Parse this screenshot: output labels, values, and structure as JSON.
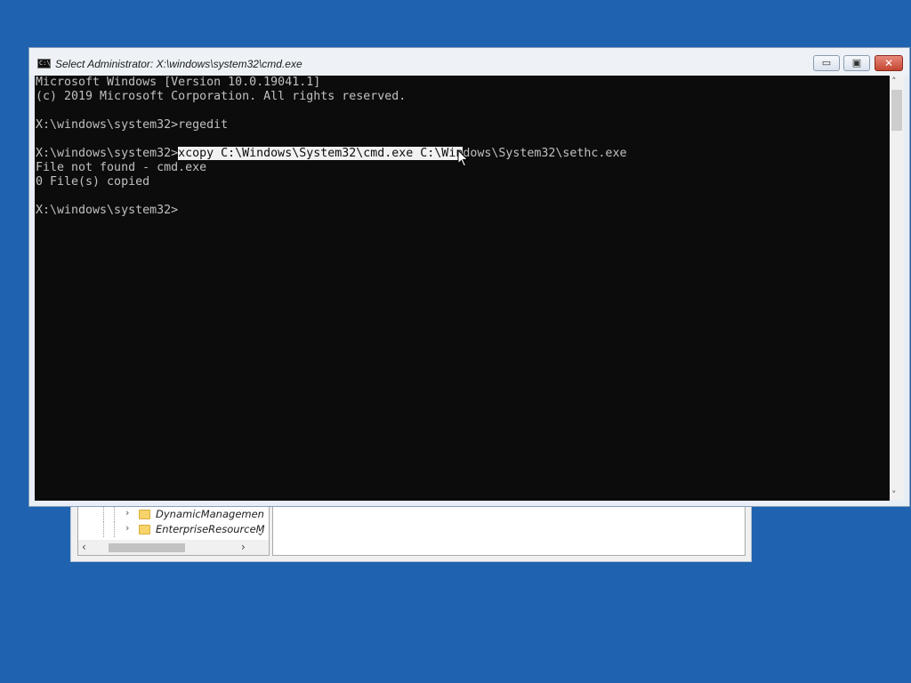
{
  "regedit": {
    "tree_items": [
      {
        "label": "DynamicManagemen",
        "expander": "›"
      },
      {
        "label": "EnterpriseResourceM",
        "expander": "›"
      }
    ],
    "tree_vscroll_glyph": "⌄",
    "hscroll_left_glyph": "‹",
    "hscroll_right_glyph": "›"
  },
  "cmd": {
    "title": "Select Administrator: X:\\windows\\system32\\cmd.exe",
    "icon_text": "C:\\",
    "buttons": {
      "minimize": "▭",
      "maximize": "▣",
      "close": "✕"
    },
    "lines": [
      {
        "text": "Microsoft Windows [Version 10.0.19041.1]"
      },
      {
        "text": "(c) 2019 Microsoft Corporation. All rights reserved."
      },
      {
        "text": ""
      },
      {
        "text": "X:\\windows\\system32>regedit"
      },
      {
        "text": ""
      },
      {
        "prompt": "X:\\windows\\system32>",
        "selected": "xcopy C:\\Windows\\System32\\cmd.exe C:\\Win",
        "rest": "dows\\System32\\sethc.exe"
      },
      {
        "text": "File not found - cmd.exe"
      },
      {
        "text": "0 File(s) copied"
      },
      {
        "text": ""
      },
      {
        "text": "X:\\windows\\system32>"
      }
    ],
    "scroll_up_glyph": "˄",
    "scroll_down_glyph": "˅"
  }
}
